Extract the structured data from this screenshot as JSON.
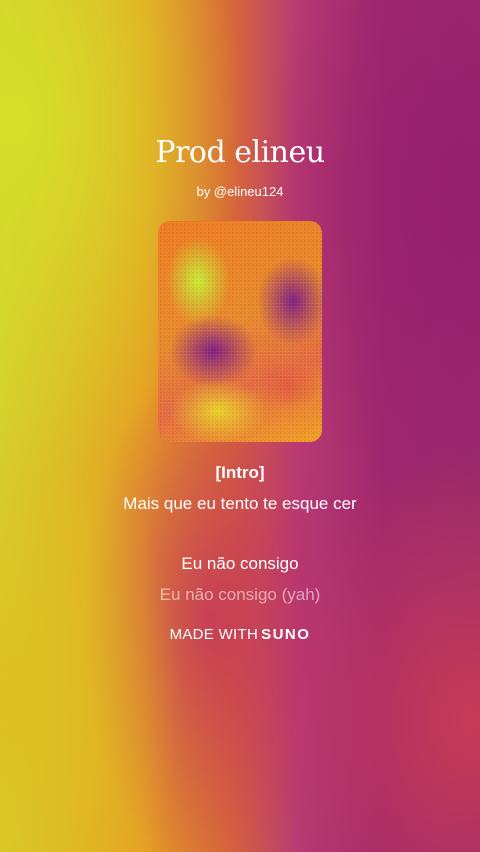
{
  "song": {
    "title": "Prod elineu",
    "byline": "by @elineu124"
  },
  "lyrics": {
    "section": "[Intro]",
    "line_1": "Mais que eu tento te esque cer",
    "line_2": "Eu não consigo",
    "line_3": "Eu não consigo (yah)"
  },
  "footer": {
    "made_with": "MADE WITH",
    "brand": "SUNO"
  },
  "colors": {
    "left_gradient": "#d4cf2c",
    "right_gradient": "#9a2a6c",
    "bottom_right": "#c83c55"
  }
}
